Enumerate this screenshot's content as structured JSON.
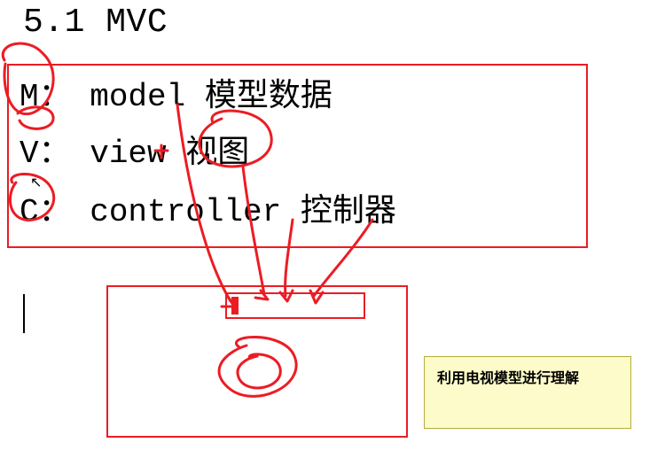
{
  "heading": "5.1 MVC",
  "lines": {
    "m_label": "M：",
    "m_en": "model",
    "m_zh": "模型数据",
    "v_label": "V：",
    "v_en": "view",
    "v_zh": "视图",
    "c_label": "C：",
    "c_en": "controller",
    "c_zh": "控制器"
  },
  "note_text": "利用电视模型进行理解",
  "colors": {
    "annotation": "#ec1c24",
    "note_bg": "#fdfbc9",
    "note_border": "#b5ad3c"
  }
}
